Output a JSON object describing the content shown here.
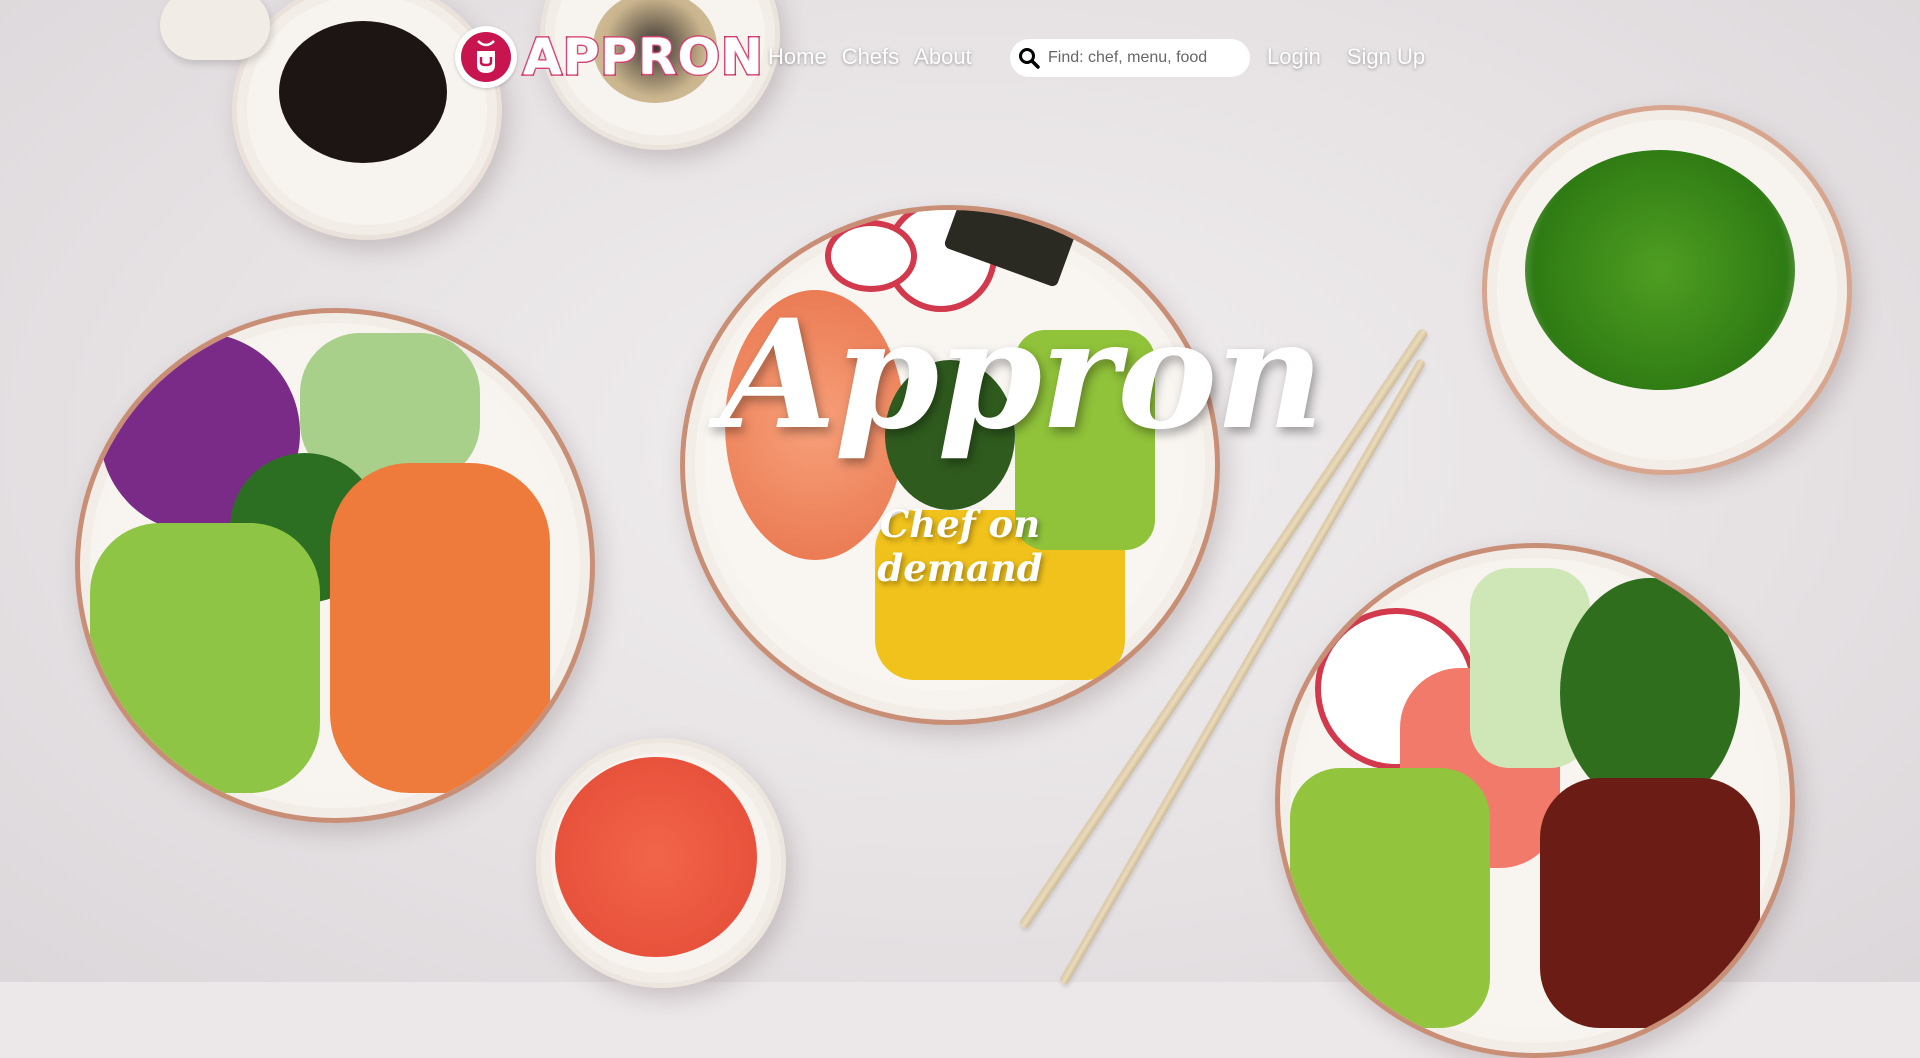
{
  "brand": {
    "name": "APPRON",
    "logo_icon": "apron-icon",
    "accent": "#c8154f"
  },
  "nav": {
    "links": [
      {
        "label": "Home"
      },
      {
        "label": "Chefs"
      },
      {
        "label": "About"
      }
    ],
    "search": {
      "placeholder": "Find: chef, menu, food",
      "value": "",
      "icon": "search-icon"
    },
    "login_label": "Login",
    "signup_label": "Sign Up"
  },
  "hero": {
    "title": "Appron",
    "subtitle": "Chef on demand"
  }
}
